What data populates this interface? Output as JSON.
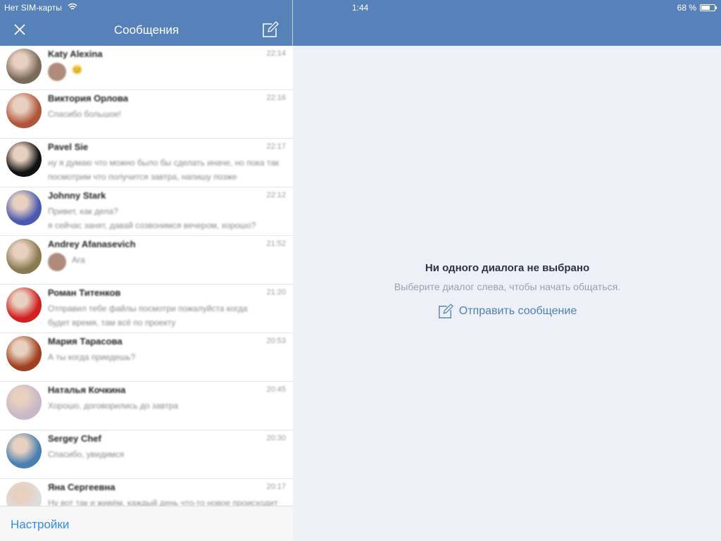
{
  "status": {
    "carrier": "Нет SIM-карты",
    "time": "1:44",
    "battery": "68 %",
    "battery_level": 0.68
  },
  "header": {
    "title": "Сообщения"
  },
  "dialogs": [
    {
      "name": "Katy Alexina",
      "time": "22:14",
      "lines": [
        "😊"
      ],
      "color": "#7a6a5a",
      "mini": true
    },
    {
      "name": "Виктория Орлова",
      "time": "22:16",
      "lines": [
        "Спасибо большое!"
      ],
      "color": "#b0553a"
    },
    {
      "name": "Pavel Sie",
      "time": "22:17",
      "lines": [
        "ну я думаю что можно было бы сделать иначе, но пока так",
        "посмотрим что получится завтра, напишу позже"
      ],
      "color": "#111"
    },
    {
      "name": "Johnny Stark",
      "time": "22:12",
      "lines": [
        "Привет, как дела?",
        "я сейчас занят, давай созвонимся вечером, хорошо?"
      ],
      "color": "#4a5ab0"
    },
    {
      "name": "Andrey Afanasevich",
      "time": "21:52",
      "lines": [
        "Ага"
      ],
      "color": "#8a7a50",
      "mini": true
    },
    {
      "name": "Роман Титенков",
      "time": "21:20",
      "lines": [
        "Отправил тебе файлы посмотри пожалуйста когда",
        "будет время, там всё по проекту"
      ],
      "color": "#d02020"
    },
    {
      "name": "Мария Тарасова",
      "time": "20:53",
      "lines": [
        "А ты когда приедешь?"
      ],
      "color": "#a04020"
    },
    {
      "name": "Наталья Кочкина",
      "time": "20:45",
      "lines": [
        "Хорошо, договорились до завтра"
      ],
      "color": "#c8b8c8"
    },
    {
      "name": "Sergey Chef",
      "time": "20:30",
      "lines": [
        "Спасибо, увидимся"
      ],
      "color": "#4a80b0"
    },
    {
      "name": "Яна Сергеевна",
      "time": "20:17",
      "lines": [
        "Ну вот так и живём, каждый день что-то новое происходит"
      ],
      "color": "#ddd"
    }
  ],
  "footer": {
    "settings": "Настройки"
  },
  "empty": {
    "title": "Ни одного диалога не выбрано",
    "subtitle": "Выберите диалог слева, чтобы начать общаться.",
    "action": "Отправить сообщение"
  },
  "colors": {
    "header": "#5782b9",
    "link": "#4d7fba",
    "background": "#edf1f7"
  }
}
